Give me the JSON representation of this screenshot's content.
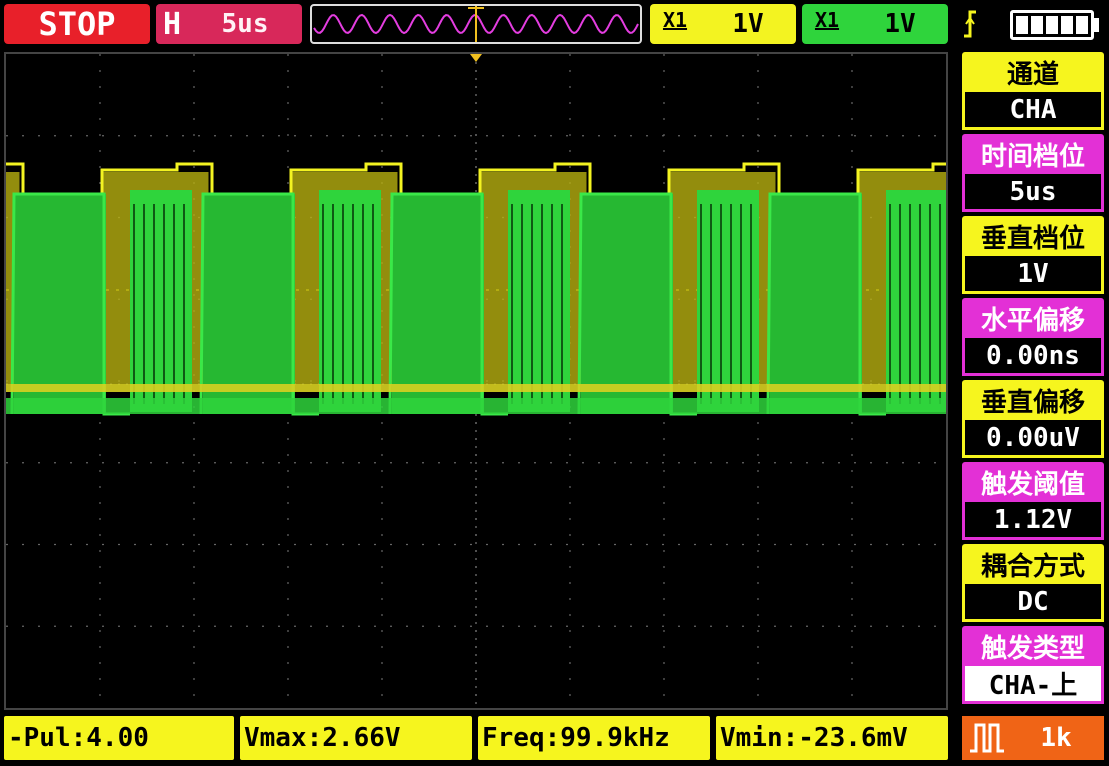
{
  "status": {
    "run_state": "STOP",
    "time_label": "H",
    "time_value": "5us"
  },
  "channels": {
    "a": {
      "coupling_mark": "X1",
      "volts": "1V",
      "color": "#f3f321"
    },
    "b": {
      "coupling_mark": "X1",
      "volts": "1V",
      "color": "#2fd43c"
    }
  },
  "icons": {
    "trigger": "trigger-rising-icon",
    "battery": "battery-icon",
    "pulse": "pulse-icon"
  },
  "menu": [
    {
      "label": "通道",
      "value": "CHA",
      "color": "#f6f51e"
    },
    {
      "label": "时间档位",
      "value": "5us",
      "color": "#e330d6"
    },
    {
      "label": "垂直档位",
      "value": "1V",
      "color": "#f6f51e"
    },
    {
      "label": "水平偏移",
      "value": "0.00ns",
      "color": "#e330d6"
    },
    {
      "label": "垂直偏移",
      "value": "0.00uV",
      "color": "#f6f51e"
    },
    {
      "label": "触发阈值",
      "value": "1.12V",
      "color": "#e330d6"
    },
    {
      "label": "耦合方式",
      "value": "DC",
      "color": "#f6f51e"
    },
    {
      "label": "触发类型",
      "value": "CHA-上",
      "color": "#e330d6"
    }
  ],
  "measurements": {
    "pulse": "-Pul:4.00",
    "vmax": "Vmax:2.66V",
    "freq": "Freq:99.9kHz",
    "vmin": "Vmin:-23.6mV"
  },
  "sample_depth": "1k"
}
